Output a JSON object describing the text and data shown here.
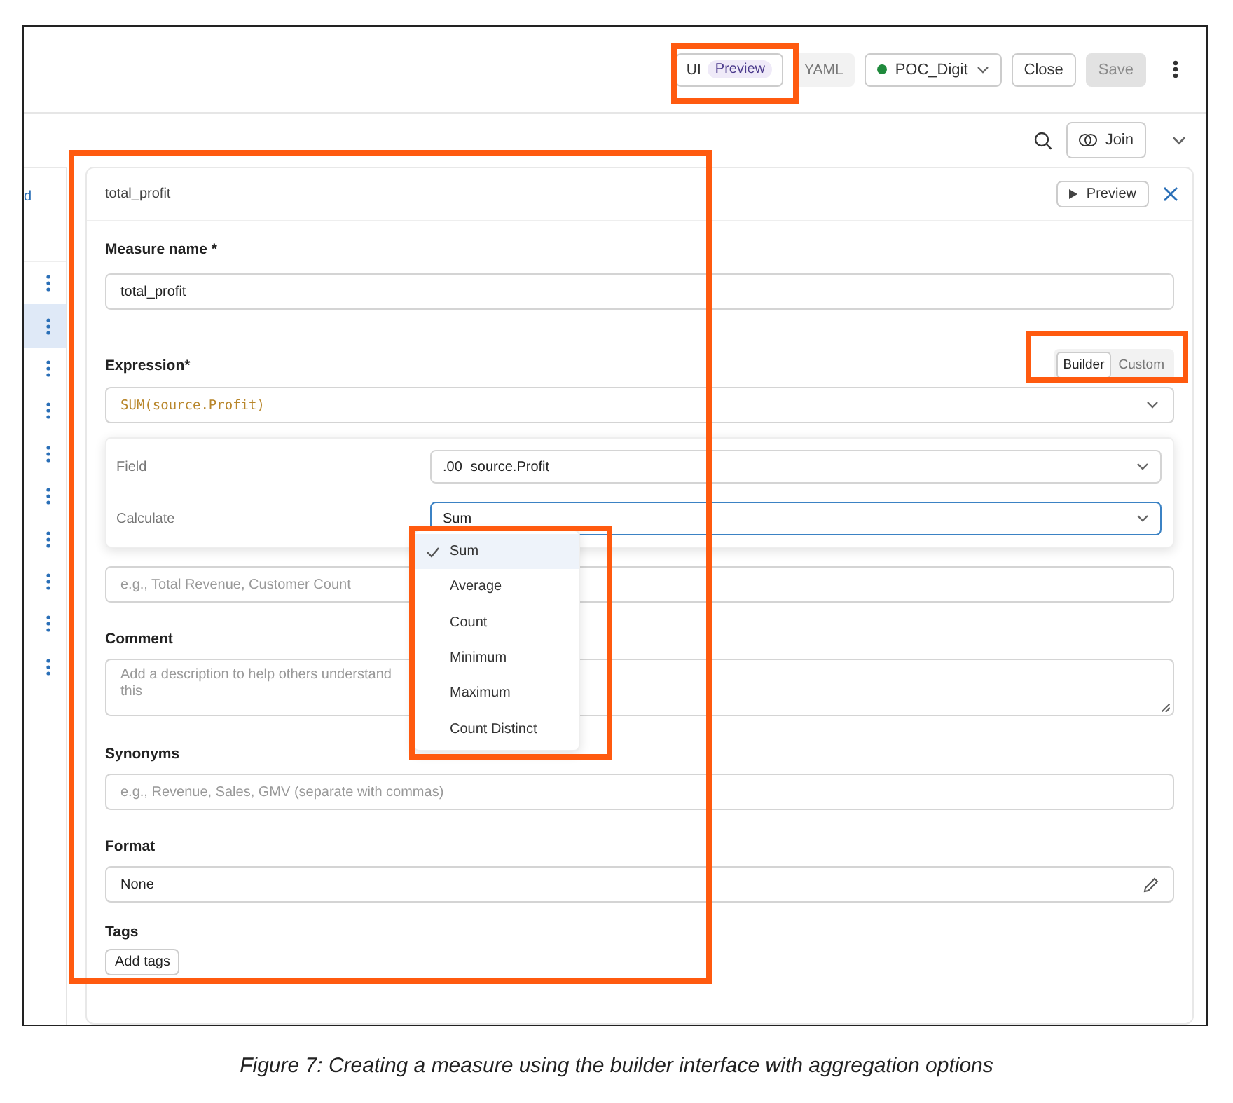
{
  "toolbar": {
    "view_tabs": [
      {
        "label": "UI",
        "badge": "Preview",
        "selected": true
      },
      {
        "label": "YAML",
        "selected": false
      }
    ],
    "connection": "POC_Digit",
    "buttons": [
      {
        "label": "Close",
        "disabled": false
      },
      {
        "label": "Save",
        "disabled": true
      }
    ]
  },
  "subbar": {
    "join_label": "Join"
  },
  "sidebar": {
    "link_text": "d",
    "rows": [
      {
        "selected": false
      },
      {
        "selected": true
      },
      {
        "selected": false
      },
      {
        "selected": false
      },
      {
        "selected": false
      },
      {
        "selected": false
      },
      {
        "selected": false
      },
      {
        "selected": false
      },
      {
        "selected": false
      },
      {
        "selected": false
      }
    ]
  },
  "editor": {
    "title": "total_profit",
    "preview_label": "Preview",
    "measure_name": {
      "label": "Measure name *",
      "value": "total_profit"
    },
    "expression": {
      "label": "Expression*",
      "value": "SUM(source.Profit)",
      "modes": [
        {
          "label": "Builder",
          "selected": true
        },
        {
          "label": "Custom",
          "selected": false
        }
      ]
    },
    "builder": {
      "field_label": "Field",
      "field_type": ".00",
      "field_value": "source.Profit",
      "calculate_label": "Calculate",
      "calculate_value": "Sum"
    },
    "calculate_menu": [
      {
        "label": "Sum",
        "selected": true
      },
      {
        "label": "Average",
        "selected": false
      },
      {
        "label": "Count",
        "selected": false
      },
      {
        "label": "Minimum",
        "selected": false
      },
      {
        "label": "Maximum",
        "selected": false
      },
      {
        "label": "Count Distinct",
        "selected": false
      }
    ],
    "display_name": {
      "placeholder": "e.g., Total Revenue, Customer Count"
    },
    "comment": {
      "label": "Comment",
      "placeholder": "Add a description to help others understand this"
    },
    "synonyms": {
      "label": "Synonyms",
      "placeholder": "e.g., Revenue, Sales, GMV (separate with commas)"
    },
    "format": {
      "label": "Format",
      "value": "None"
    },
    "tags": {
      "label": "Tags",
      "button": "Add tags"
    }
  },
  "caption": "Figure 7: Creating a measure using the builder interface with aggregation options"
}
